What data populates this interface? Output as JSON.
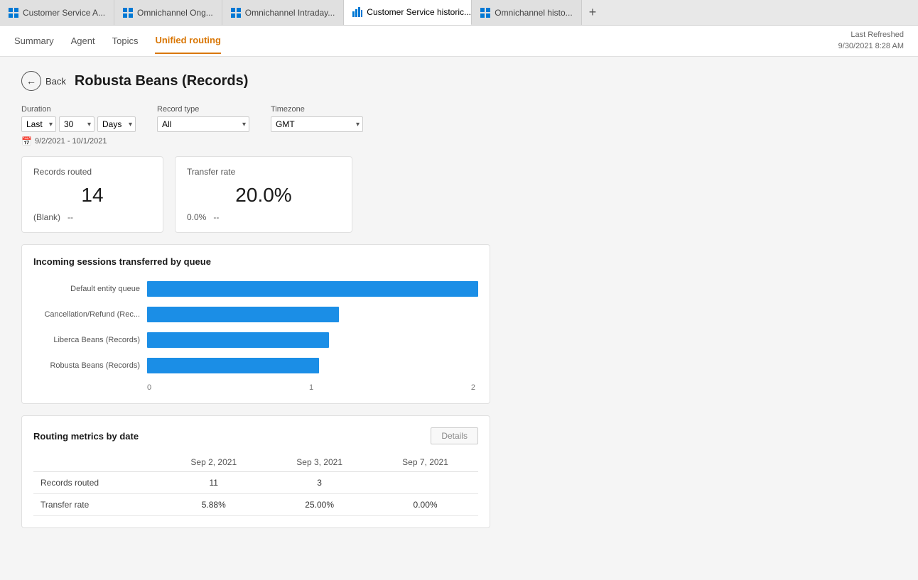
{
  "tabs": [
    {
      "id": "tab1",
      "icon": "grid-icon",
      "label": "Customer Service A...",
      "active": false,
      "closable": false
    },
    {
      "id": "tab2",
      "icon": "grid-icon",
      "label": "Omnichannel Ong...",
      "active": false,
      "closable": false
    },
    {
      "id": "tab3",
      "icon": "grid-icon",
      "label": "Omnichannel Intraday...",
      "active": false,
      "closable": false
    },
    {
      "id": "tab4",
      "icon": "chart-icon",
      "label": "Customer Service historic...",
      "active": true,
      "closable": true
    },
    {
      "id": "tab5",
      "icon": "grid-icon",
      "label": "Omnichannel histo...",
      "active": false,
      "closable": false
    }
  ],
  "nav": {
    "links": [
      "Summary",
      "Agent",
      "Topics",
      "Unified routing"
    ],
    "active_link": "Unified routing"
  },
  "last_refreshed": {
    "label": "Last Refreshed",
    "value": "9/30/2021 8:28 AM"
  },
  "back_button": "Back",
  "page_title": "Robusta Beans (Records)",
  "filters": {
    "duration_label": "Duration",
    "duration_preset": "Last",
    "duration_value": "30",
    "duration_unit": "Days",
    "record_type_label": "Record type",
    "record_type_value": "All",
    "timezone_label": "Timezone",
    "timezone_value": "GMT",
    "date_range": "9/2/2021 - 10/1/2021"
  },
  "cards": [
    {
      "title": "Records routed",
      "value": "14",
      "sub_label": "(Blank)",
      "sub_value": "--"
    },
    {
      "title": "Transfer rate",
      "value": "20.0%",
      "sub_label": "0.0%",
      "sub_value": "--"
    }
  ],
  "bar_chart": {
    "title": "Incoming sessions transferred by queue",
    "bars": [
      {
        "label": "Default entity queue",
        "value": 2,
        "max": 2,
        "pct": 100
      },
      {
        "label": "Cancellation/Refund (Rec...",
        "value": 1,
        "max": 2,
        "pct": 58
      },
      {
        "label": "Liberca Beans (Records)",
        "value": 1,
        "max": 2,
        "pct": 55
      },
      {
        "label": "Robusta Beans (Records)",
        "value": 1,
        "max": 2,
        "pct": 52
      }
    ],
    "axis": [
      {
        "label": "0",
        "pos": "0%"
      },
      {
        "label": "1",
        "pos": "48%"
      },
      {
        "label": "2",
        "pos": "96%"
      }
    ]
  },
  "routing_table": {
    "title": "Routing metrics by date",
    "details_button": "Details",
    "columns": [
      "",
      "Sep 2, 2021",
      "Sep 3, 2021",
      "Sep 7, 2021"
    ],
    "rows": [
      {
        "metric": "Records routed",
        "values": [
          "11",
          "3",
          ""
        ]
      },
      {
        "metric": "Transfer rate",
        "values": [
          "5.88%",
          "25.00%",
          "0.00%"
        ]
      }
    ]
  }
}
